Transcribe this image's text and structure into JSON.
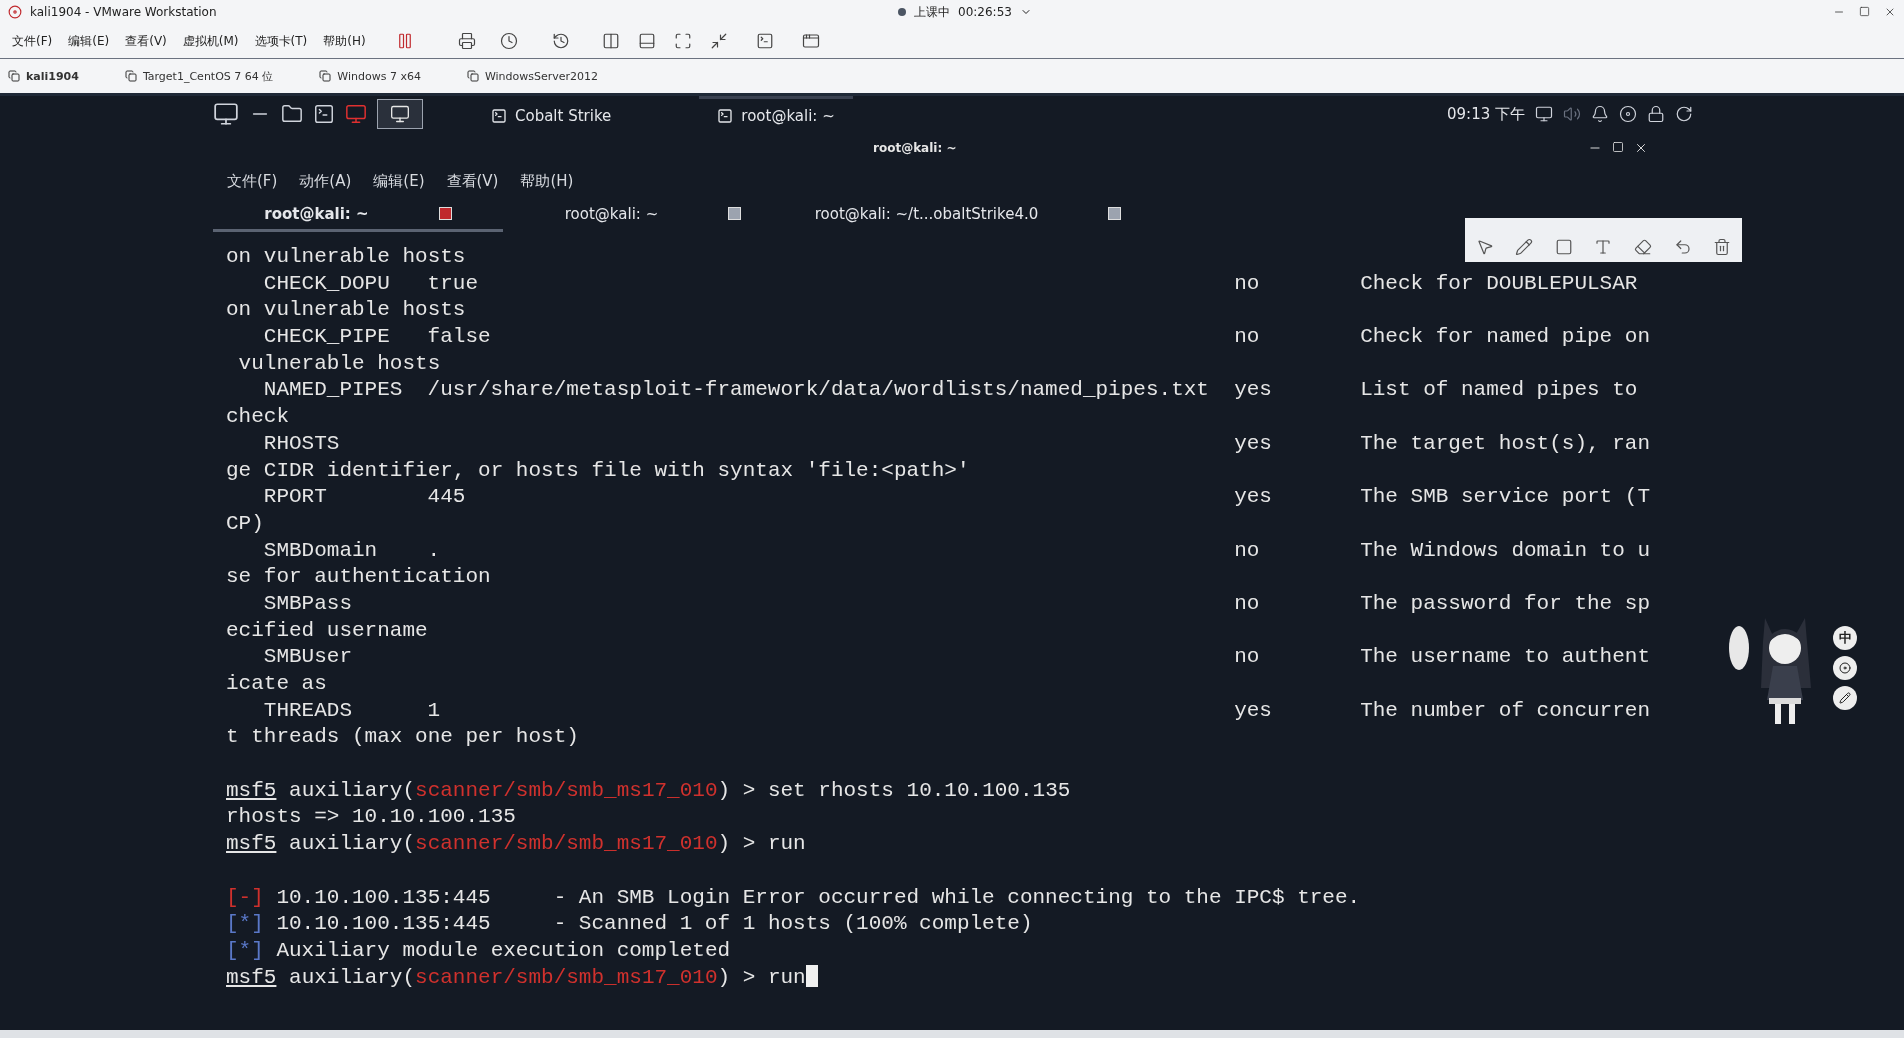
{
  "vmware": {
    "title": "kali1904 - VMware Workstation",
    "session": {
      "live": true,
      "status": "上课中",
      "timer": "00:26:53"
    },
    "menu": [
      "文件(F)",
      "编辑(E)",
      "查看(V)",
      "虚拟机(M)",
      "选项卡(T)",
      "帮助(H)"
    ],
    "tabs": [
      {
        "label": "kali1904",
        "selected": true
      },
      {
        "label": "Target1_CentOS 7 64 位",
        "selected": false
      },
      {
        "label": "Windows 7 x64",
        "selected": false
      },
      {
        "label": "WindowsServer2012",
        "selected": false
      }
    ]
  },
  "kali_panel": {
    "apps": [
      {
        "label": "Cobalt Strike",
        "selected": false
      },
      {
        "label": "root@kali: ~",
        "selected": true
      }
    ],
    "clock": "09:13 下午"
  },
  "terminal": {
    "title": "root@kali: ~",
    "menu": [
      "文件(F)",
      "动作(A)",
      "编辑(E)",
      "查看(V)",
      "帮助(H)"
    ],
    "tabs": [
      {
        "label": "root@kali: ~",
        "selected": true
      },
      {
        "label": "root@kali: ~",
        "selected": false
      },
      {
        "label": "root@kali: ~/t...obaltStrike4.0",
        "selected": false
      }
    ],
    "lines": [
      {
        "kind": "text",
        "text": "on vulnerable hosts"
      },
      {
        "kind": "option",
        "name": "CHECK_DOPU",
        "value": "true",
        "required": "no",
        "description": "Check for DOUBLEPULSAR"
      },
      {
        "kind": "text",
        "text": "on vulnerable hosts"
      },
      {
        "kind": "option",
        "name": "CHECK_PIPE",
        "value": "false",
        "required": "no",
        "description": "Check for named pipe on"
      },
      {
        "kind": "text",
        "text": " vulnerable hosts"
      },
      {
        "kind": "option",
        "name": "NAMED_PIPES",
        "value": "/usr/share/metasploit-framework/data/wordlists/named_pipes.txt",
        "required": "yes",
        "description": "List of named pipes to"
      },
      {
        "kind": "text",
        "text": "check"
      },
      {
        "kind": "option",
        "name": "RHOSTS",
        "required": "yes",
        "description": "The target host(s), ran"
      },
      {
        "kind": "text",
        "text": "ge CIDR identifier, or hosts file with syntax 'file:<path>'"
      },
      {
        "kind": "option",
        "name": "RPORT",
        "value": "445",
        "required": "yes",
        "description": "The SMB service port (T"
      },
      {
        "kind": "text",
        "text": "CP)"
      },
      {
        "kind": "option",
        "name": "SMBDomain",
        "value": ".",
        "required": "no",
        "description": "The Windows domain to u"
      },
      {
        "kind": "text",
        "text": "se for authentication"
      },
      {
        "kind": "option",
        "name": "SMBPass",
        "required": "no",
        "description": "The password for the sp"
      },
      {
        "kind": "text",
        "text": "ecified username"
      },
      {
        "kind": "option",
        "name": "SMBUser",
        "required": "no",
        "description": "The username to authent"
      },
      {
        "kind": "text",
        "text": "icate as"
      },
      {
        "kind": "option",
        "name": "THREADS",
        "value": "1",
        "required": "yes",
        "description": "The number of concurren"
      },
      {
        "kind": "text",
        "text": "t threads (max one per host)"
      },
      {
        "kind": "blank"
      },
      {
        "kind": "prompt",
        "segments": [
          "msf5",
          " auxiliary(",
          "scanner/smb/smb_ms17_010",
          ") > set rhosts 10.10.100.135"
        ]
      },
      {
        "kind": "text",
        "text": "rhosts => 10.10.100.135"
      },
      {
        "kind": "prompt",
        "segments": [
          "msf5",
          " auxiliary(",
          "scanner/smb/smb_ms17_010",
          ") > run"
        ]
      },
      {
        "kind": "blank"
      },
      {
        "kind": "status",
        "color": "#d0312d",
        "mark": "[-]",
        "host": "10.10.100.135:445",
        "message": "- An SMB Login Error occurred while connecting to the IPC$ tree."
      },
      {
        "kind": "status",
        "color": "#5a78c8",
        "mark": "[*]",
        "host": "10.10.100.135:445",
        "message": "- Scanned 1 of 1 hosts (100% complete)"
      },
      {
        "kind": "status",
        "color": "#5a78c8",
        "mark": "[*]",
        "message": "Auxiliary module execution completed"
      },
      {
        "kind": "prompt",
        "cursor": true,
        "segments": [
          "msf5",
          " auxiliary(",
          "scanner/smb/smb_ms17_010",
          ") > run"
        ]
      }
    ]
  },
  "ime": {
    "mode": "中"
  }
}
